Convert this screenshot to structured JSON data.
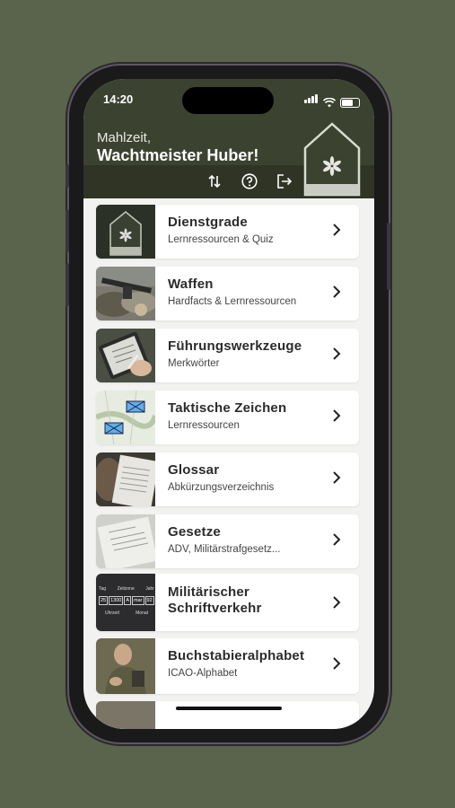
{
  "status_bar": {
    "time": "14:20"
  },
  "header": {
    "greeting": "Mahlzeit,",
    "name": "Wachtmeister Huber!",
    "icons": [
      "sort-icon",
      "help-icon",
      "logout-icon"
    ]
  },
  "menu": {
    "items": [
      {
        "title": "Dienstgrade",
        "subtitle": "Lernressourcen & Quiz",
        "thumb": "rank-insignia-image"
      },
      {
        "title": "Waffen",
        "subtitle": "Hardfacts & Lernressourcen",
        "thumb": "weapon-image"
      },
      {
        "title": "Führungswerkzeuge",
        "subtitle": "Merkwörter",
        "thumb": "tablet-writing-image"
      },
      {
        "title": "Taktische Zeichen",
        "subtitle": "Lernressourcen",
        "thumb": "tactical-map-image"
      },
      {
        "title": "Glossar",
        "subtitle": "Abkürzungsverzeichnis",
        "thumb": "reading-image"
      },
      {
        "title": "Gesetze",
        "subtitle": "ADV, Militärstrafgesetz...",
        "thumb": "paper-document-image"
      },
      {
        "title": "Militärischer Schriftverkehr",
        "subtitle": "",
        "thumb": "date-format-image"
      },
      {
        "title": "Buchstabieralphabet",
        "subtitle": "ICAO-Alphabet",
        "thumb": "soldier-image"
      }
    ]
  },
  "date_format_thumb": {
    "tag": "Tag",
    "zeit": "Zeitzone",
    "jahr": "Jahr",
    "uhrzeit": "Uhrzeit",
    "monat": "Monat",
    "value_day": "25",
    "value_time": "1300",
    "value_zone": "A",
    "value_month": "mar",
    "value_year": "92"
  },
  "colors": {
    "header": "#3c4230",
    "background": "#5a634b",
    "card": "#ffffff"
  }
}
